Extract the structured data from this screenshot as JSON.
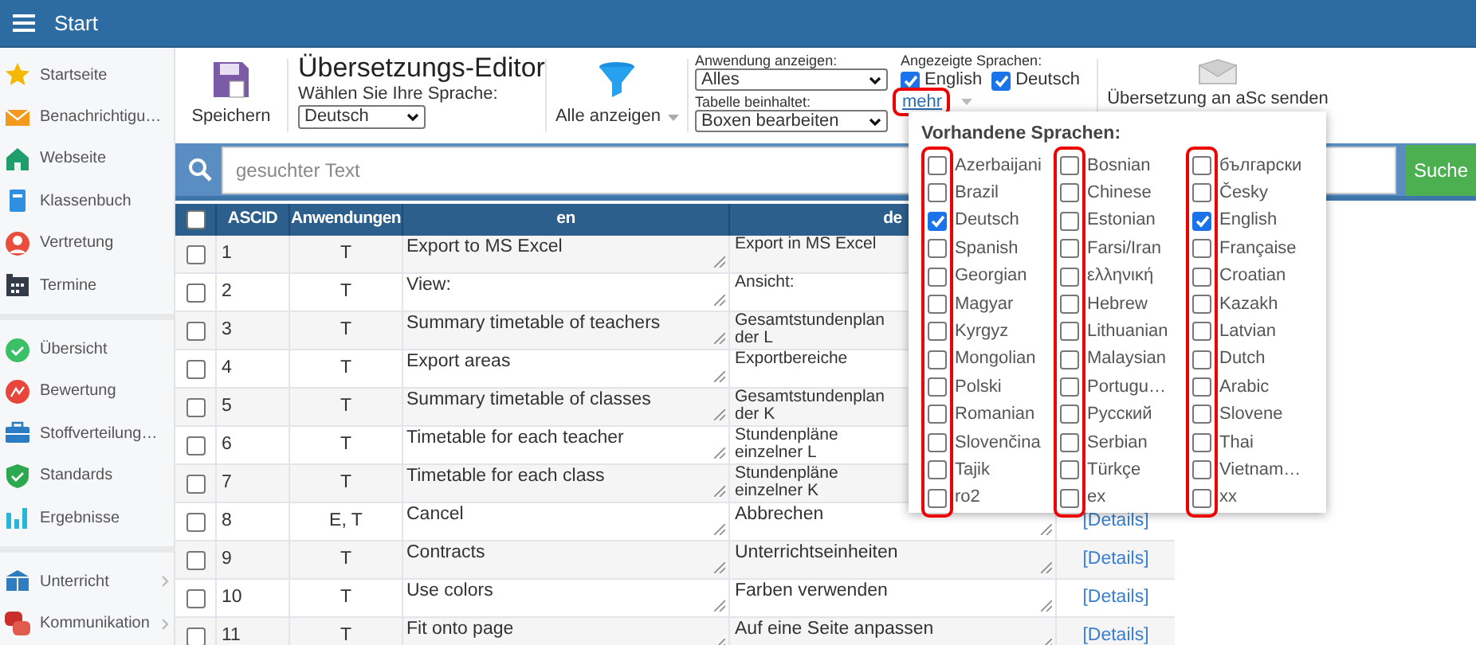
{
  "topbar": {
    "title": "Start"
  },
  "sidebar": {
    "groups": [
      [
        {
          "label": "Startseite",
          "has_submenu": false
        },
        {
          "label": "Benachrichtigu…",
          "has_submenu": false
        },
        {
          "label": "Webseite",
          "has_submenu": false
        },
        {
          "label": "Klassenbuch",
          "has_submenu": false
        },
        {
          "label": "Vertretung",
          "has_submenu": false
        },
        {
          "label": "Termine",
          "has_submenu": false
        }
      ],
      [
        {
          "label": "Übersicht",
          "has_submenu": false
        },
        {
          "label": "Bewertung",
          "has_submenu": false
        },
        {
          "label": "Stoffverteilung…",
          "has_submenu": false
        },
        {
          "label": "Standards",
          "has_submenu": false
        },
        {
          "label": "Ergebnisse",
          "has_submenu": false
        }
      ],
      [
        {
          "label": "Unterricht",
          "has_submenu": true
        },
        {
          "label": "Kommunikation",
          "has_submenu": true
        }
      ]
    ]
  },
  "toolbar": {
    "save_button": "Speichern",
    "title": "Übersetzungs-Editor",
    "language_label": "Wählen Sie Ihre Sprache:",
    "language_value": "Deutsch",
    "filter_button": "Alle anzeigen",
    "app_label": "Anwendung anzeigen:",
    "app_value": "Alles",
    "table_label": "Tabelle beinhaltet:",
    "table_value": "Boxen bearbeiten",
    "shown_label": "Angezeigte Sprachen:",
    "shown": [
      {
        "label": "English",
        "checked": true
      },
      {
        "label": "Deutsch",
        "checked": true
      }
    ],
    "more_link": "mehr",
    "send_button": "Übersetzung an aSc senden"
  },
  "search": {
    "placeholder": "gesuchter Text",
    "button": "Suche"
  },
  "table": {
    "header_checked": false,
    "columns": [
      "ASCID",
      "Anwendungen",
      "en",
      "de"
    ],
    "rows": [
      {
        "checked": false,
        "id": "1",
        "apps": "T",
        "en": "Export to MS Excel",
        "de": "Export in MS Excel"
      },
      {
        "checked": false,
        "id": "2",
        "apps": "T",
        "en": "View:",
        "de": "Ansicht:"
      },
      {
        "checked": false,
        "id": "3",
        "apps": "T",
        "en": "Summary timetable of teachers",
        "de": "Gesamtstundenplan der L"
      },
      {
        "checked": false,
        "id": "4",
        "apps": "T",
        "en": "Export areas",
        "de": "Exportbereiche"
      },
      {
        "checked": false,
        "id": "5",
        "apps": "T",
        "en": "Summary timetable of classes",
        "de": "Gesamtstundenplan der K"
      },
      {
        "checked": false,
        "id": "6",
        "apps": "T",
        "en": "Timetable for each teacher",
        "de": "Stundenpläne einzelner L"
      },
      {
        "checked": false,
        "id": "7",
        "apps": "T",
        "en": "Timetable for each class",
        "de": "Stundenpläne einzelner K"
      },
      {
        "checked": false,
        "id": "8",
        "apps": "E, T",
        "en": "Cancel",
        "de": "Abbrechen",
        "details": "[Details]"
      },
      {
        "checked": false,
        "id": "9",
        "apps": "T",
        "en": "Contracts",
        "de": "Unterrichtseinheiten",
        "details": "[Details]"
      },
      {
        "checked": false,
        "id": "10",
        "apps": "T",
        "en": "Use colors",
        "de": "Farben verwenden",
        "details": "[Details]"
      },
      {
        "checked": false,
        "id": "11",
        "apps": "T",
        "en": "Fit onto page",
        "de": "Auf eine Seite anpassen",
        "details": "[Details]"
      }
    ]
  },
  "languages_popup": {
    "title": "Vorhandene Sprachen:",
    "columns": [
      [
        {
          "label": "Azerbaijani",
          "checked": false
        },
        {
          "label": "Brazil",
          "checked": false
        },
        {
          "label": "Deutsch",
          "checked": true
        },
        {
          "label": "Spanish",
          "checked": false
        },
        {
          "label": "Georgian",
          "checked": false
        },
        {
          "label": "Magyar",
          "checked": false
        },
        {
          "label": "Kyrgyz",
          "checked": false
        },
        {
          "label": "Mongolian",
          "checked": false
        },
        {
          "label": "Polski",
          "checked": false
        },
        {
          "label": "Romanian",
          "checked": false
        },
        {
          "label": "Slovenčina",
          "checked": false
        },
        {
          "label": "Tajik",
          "checked": false
        },
        {
          "label": "ro2",
          "checked": false
        }
      ],
      [
        {
          "label": "Bosnian",
          "checked": false
        },
        {
          "label": "Chinese",
          "checked": false
        },
        {
          "label": "Estonian",
          "checked": false
        },
        {
          "label": "Farsi/Iran",
          "checked": false
        },
        {
          "label": "ελληνική",
          "checked": false
        },
        {
          "label": "Hebrew",
          "checked": false
        },
        {
          "label": "Lithuanian",
          "checked": false
        },
        {
          "label": "Malaysian",
          "checked": false
        },
        {
          "label": "Portugu…",
          "checked": false
        },
        {
          "label": "Русский",
          "checked": false
        },
        {
          "label": "Serbian",
          "checked": false
        },
        {
          "label": "Türkçe",
          "checked": false
        },
        {
          "label": "ex",
          "checked": false
        }
      ],
      [
        {
          "label": "български",
          "checked": false
        },
        {
          "label": "Česky",
          "checked": false
        },
        {
          "label": "English",
          "checked": true
        },
        {
          "label": "Française",
          "checked": false
        },
        {
          "label": "Croatian",
          "checked": false
        },
        {
          "label": "Kazakh",
          "checked": false
        },
        {
          "label": "Latvian",
          "checked": false
        },
        {
          "label": "Dutch",
          "checked": false
        },
        {
          "label": "Arabic",
          "checked": false
        },
        {
          "label": "Slovene",
          "checked": false
        },
        {
          "label": "Thai",
          "checked": false
        },
        {
          "label": "Vietnam…",
          "checked": false
        },
        {
          "label": "xx",
          "checked": false
        }
      ]
    ]
  }
}
